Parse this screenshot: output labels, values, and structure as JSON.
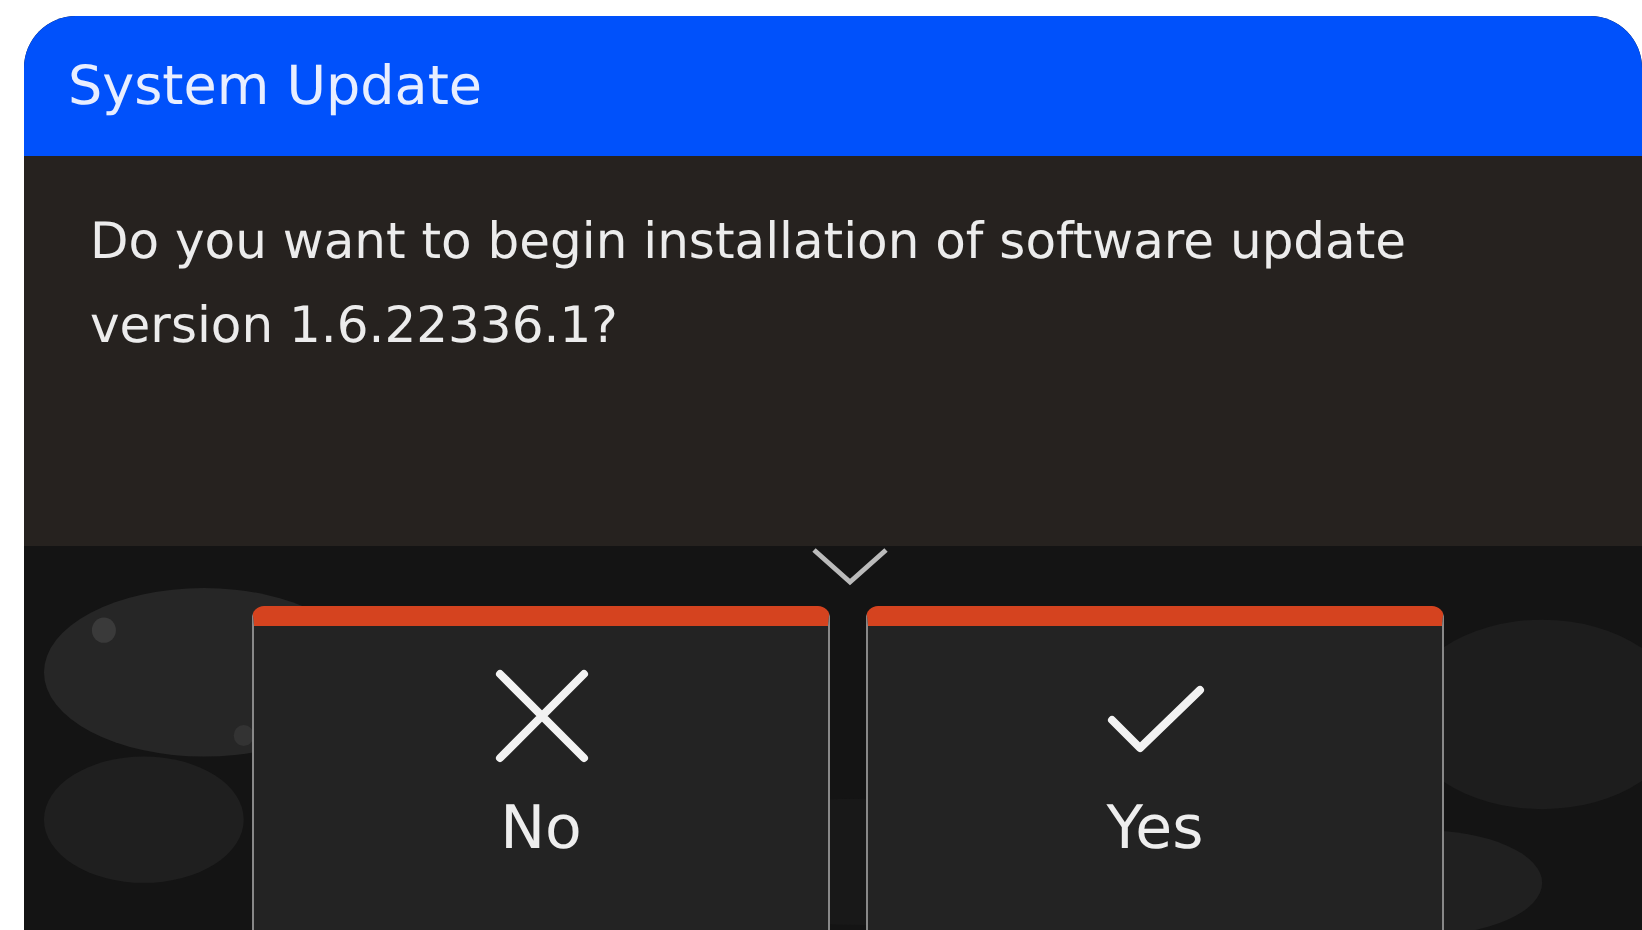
{
  "dialog": {
    "title": "System Update",
    "message": "Do you want to begin installation of software update version 1.6.22336.1?"
  },
  "buttons": [
    {
      "label": "No",
      "kind": "cancel"
    },
    {
      "label": "Yes",
      "kind": "confirm"
    }
  ]
}
